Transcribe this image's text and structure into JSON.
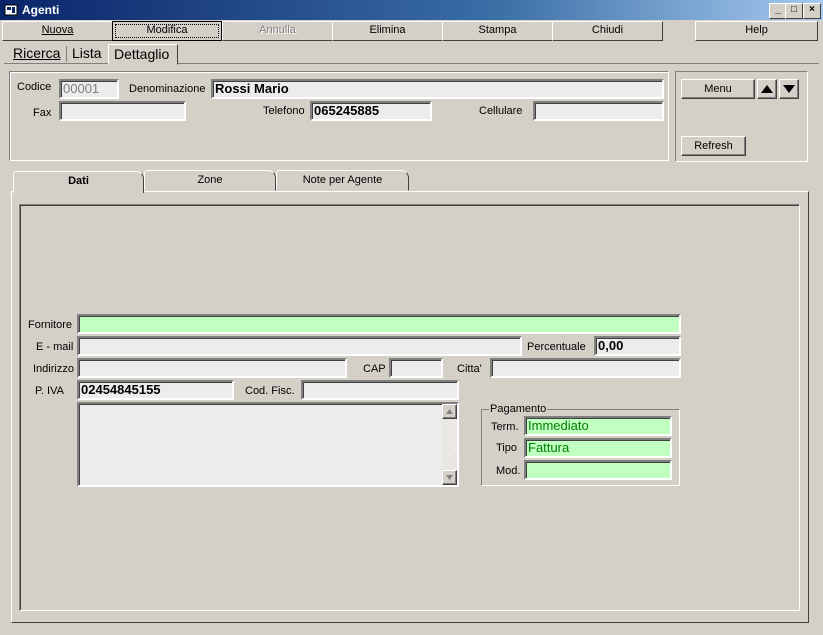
{
  "window": {
    "title": "Agenti",
    "controls": [
      "_",
      "□",
      "×"
    ]
  },
  "toolbar": {
    "nuova": "Nuova",
    "modifica": "Modifica",
    "annulla": "Annulla",
    "elimina": "Elimina",
    "stampa": "Stampa",
    "chiudi": "Chiudi",
    "help": "Help"
  },
  "nav": {
    "ricerca": "Ricerca",
    "lista": "Lista",
    "dettaglio": "Dettaglio"
  },
  "header": {
    "codice_label": "Codice",
    "codice_value": "00001",
    "denominazione_label": "Denominazione",
    "denominazione_value": "Rossi Mario",
    "fax_label": "Fax",
    "fax_value": "",
    "telefono_label": "Telefono",
    "telefono_value": "065245885",
    "cellulare_label": "Cellulare",
    "cellulare_value": ""
  },
  "side": {
    "menu": "Menu",
    "refresh": "Refresh"
  },
  "tabs": {
    "dati": "Dati",
    "zone": "Zone",
    "note": "Note per Agente"
  },
  "dati": {
    "fornitore_label": "Fornitore",
    "fornitore_value": "",
    "email_label": "E - mail",
    "email_value": "",
    "percentuale_label": "Percentuale",
    "percentuale_value": "0,00",
    "indirizzo_label": "Indirizzo",
    "indirizzo_value": "",
    "cap_label": "CAP",
    "cap_value": "",
    "citta_label": "Citta'",
    "citta_value": "",
    "piva_label": "P. IVA",
    "piva_value": "02454845155",
    "codfisc_label": "Cod. Fisc.",
    "codfisc_value": "",
    "note_value": ""
  },
  "pagamento": {
    "group_label": "Pagamento",
    "term_label": "Term.",
    "term_value": "Immediato",
    "tipo_label": "Tipo",
    "tipo_value": "Fattura",
    "mod_label": "Mod.",
    "mod_value": ""
  }
}
